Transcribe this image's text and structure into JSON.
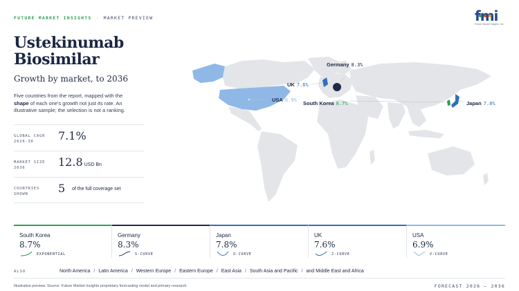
{
  "header": {
    "brand": "FUTURE MARKET INSIGHTS",
    "separator": "·",
    "section": "MARKET PREVIEW",
    "logo_text": "fmi",
    "logo_sub": "Future Market Insights, Inc."
  },
  "title": {
    "line1": "Ustekinumab",
    "line2": "Biosimilar",
    "subtitle": "Growth by market, to 2036"
  },
  "description": {
    "part1": "Five countries from the report, mapped with the ",
    "bold": "shape",
    "part2": " of each one's growth not just its rate. An illustrative sample; the selection is not a ranking."
  },
  "kpis": [
    {
      "label": "GLOBAL CAGR 2026-36",
      "value": "7.1%",
      "unit": ""
    },
    {
      "label": "MARKET SIZE 2036",
      "value": "12.8",
      "unit": "USD Bn"
    },
    {
      "label": "COUNTRIES SHOWN",
      "value": "5",
      "unit": "of the full coverage set"
    }
  ],
  "map_labels": {
    "germany": {
      "name": "Germany",
      "pct": "8.3%"
    },
    "uk": {
      "name": "UK",
      "pct": "7.6%"
    },
    "usa": {
      "name": "USA",
      "pct": "6.9%"
    },
    "south_korea": {
      "name": "South Korea",
      "pct": "8.7%"
    },
    "japan": {
      "name": "Japan",
      "pct": "7.8%"
    }
  },
  "cards": [
    {
      "name": "South Korea",
      "value": "8.7%",
      "curve": "EXPONENTIAL",
      "color": "#2e9e57"
    },
    {
      "name": "Germany",
      "value": "8.3%",
      "curve": "S-CURVE",
      "color": "#1f2a44"
    },
    {
      "name": "Japan",
      "value": "7.8%",
      "curve": "U-CURVE",
      "color": "#2f6fb8"
    },
    {
      "name": "UK",
      "value": "7.6%",
      "curve": "J-CURVE",
      "color": "#2f6fb8"
    },
    {
      "name": "USA",
      "value": "6.9%",
      "curve": "V-CURVE",
      "color": "#8fb8e6"
    }
  ],
  "also": {
    "label": "ALSO",
    "regions": [
      "North America",
      "Latin America",
      "Western Europe",
      "Eastern Europe",
      "East Asia",
      "South Asia and Pacific",
      "and Middle East and Africa"
    ]
  },
  "footer": {
    "note": "Illustrative preview. Source: Future Market Insights proprietary forecasting model and primary research.",
    "forecast": "FORECAST 2026 – 2036"
  },
  "colors": {
    "green": "#2e9e57",
    "navy": "#1f2a44",
    "blue": "#2f6fb8",
    "light_blue": "#8fb8e6",
    "land": "#e3e5e9"
  }
}
